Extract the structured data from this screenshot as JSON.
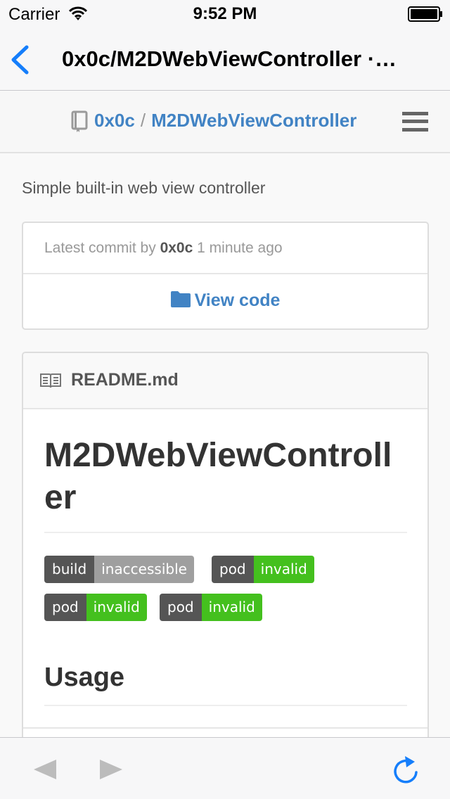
{
  "status_bar": {
    "carrier": "Carrier",
    "time": "9:52 PM",
    "icons": [
      "wifi-icon",
      "battery-icon"
    ]
  },
  "nav_bar": {
    "title": "0x0c/M2DWebViewController ·…",
    "back_icon": "chevron-left-icon"
  },
  "site_header": {
    "owner": "0x0c",
    "separator": "/",
    "repo": "M2DWebViewController",
    "icons": [
      "repo-icon",
      "menu-icon"
    ]
  },
  "repo": {
    "description": "Simple built-in web view controller"
  },
  "commit_box": {
    "prefix": "Latest commit by",
    "author": "0x0c",
    "time_ago": "1 minute ago",
    "view_code_label": "View code"
  },
  "readme": {
    "filename": "README.md",
    "h1": "M2DWebViewController",
    "h2": "Usage",
    "badges": [
      {
        "label": "build",
        "value": "inaccessible",
        "color": "#9f9f9f"
      },
      {
        "label": "pod",
        "value": "invalid",
        "color": "#44c01e"
      },
      {
        "label": "pod",
        "value": "invalid",
        "color": "#44c01e"
      },
      {
        "label": "pod",
        "value": "invalid",
        "color": "#44c01e"
      }
    ]
  },
  "toolbar": {
    "icons": [
      "back-arrow-icon",
      "forward-arrow-icon",
      "refresh-icon"
    ]
  },
  "colors": {
    "ios_tint": "#157efb",
    "link": "#4183c4"
  }
}
